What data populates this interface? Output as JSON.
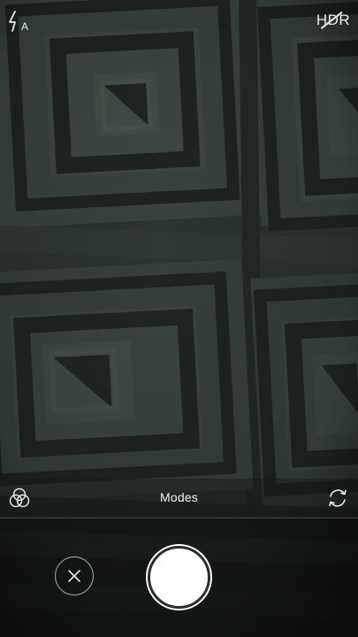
{
  "top_bar": {
    "flash_icon": "flash-auto-icon",
    "flash_suffix": "A",
    "hdr_label": "HDR",
    "hdr_state": "off"
  },
  "mode_bar": {
    "filters_icon": "filters-icon",
    "modes_label": "Modes",
    "switch_icon": "switch-camera-icon"
  },
  "bottom_bar": {
    "close_icon": "close-icon",
    "shutter_icon": "shutter-button"
  },
  "colors": {
    "viewfinder_dark": "#1a1d1b",
    "viewfinder_light": "#3e4842",
    "icon": "#e6ebe8",
    "shutter": "#ffffff"
  }
}
